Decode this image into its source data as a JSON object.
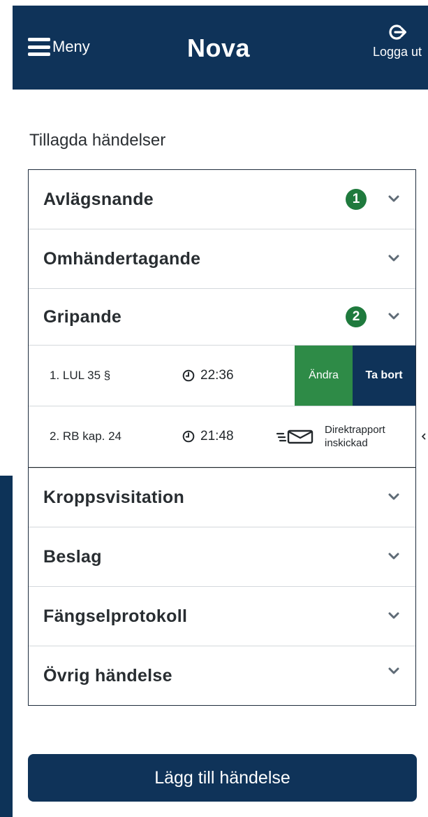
{
  "header": {
    "menu_label": "Meny",
    "app_title": "Nova",
    "logout_label": "Logga ut"
  },
  "section_title": "Tillagda händelser",
  "events": {
    "avlagsnande": {
      "label": "Avlägsnande",
      "count": "1"
    },
    "omhandertagande": {
      "label": "Omhändertagande"
    },
    "gripande": {
      "label": "Gripande",
      "count": "2",
      "entries": [
        {
          "label": "1. LUL 35 §",
          "time": "22:36",
          "edit_label": "Ändra",
          "delete_label": "Ta bort"
        },
        {
          "label": "2. RB kap. 24",
          "time": "21:48",
          "status_line1": "Direktrapport",
          "status_line2": "inskickad"
        }
      ]
    },
    "kroppsvisitation": {
      "label": "Kroppsvisitation"
    },
    "beslag": {
      "label": "Beslag"
    },
    "fangselprotokoll": {
      "label": "Fängselprotokoll"
    },
    "ovrig": {
      "label": "Övrig händelse"
    }
  },
  "add_button_label": "Lägg till händelse",
  "colors": {
    "navy": "#0f3359",
    "green": "#2e8b47",
    "badge_green": "#1f7a3d"
  }
}
